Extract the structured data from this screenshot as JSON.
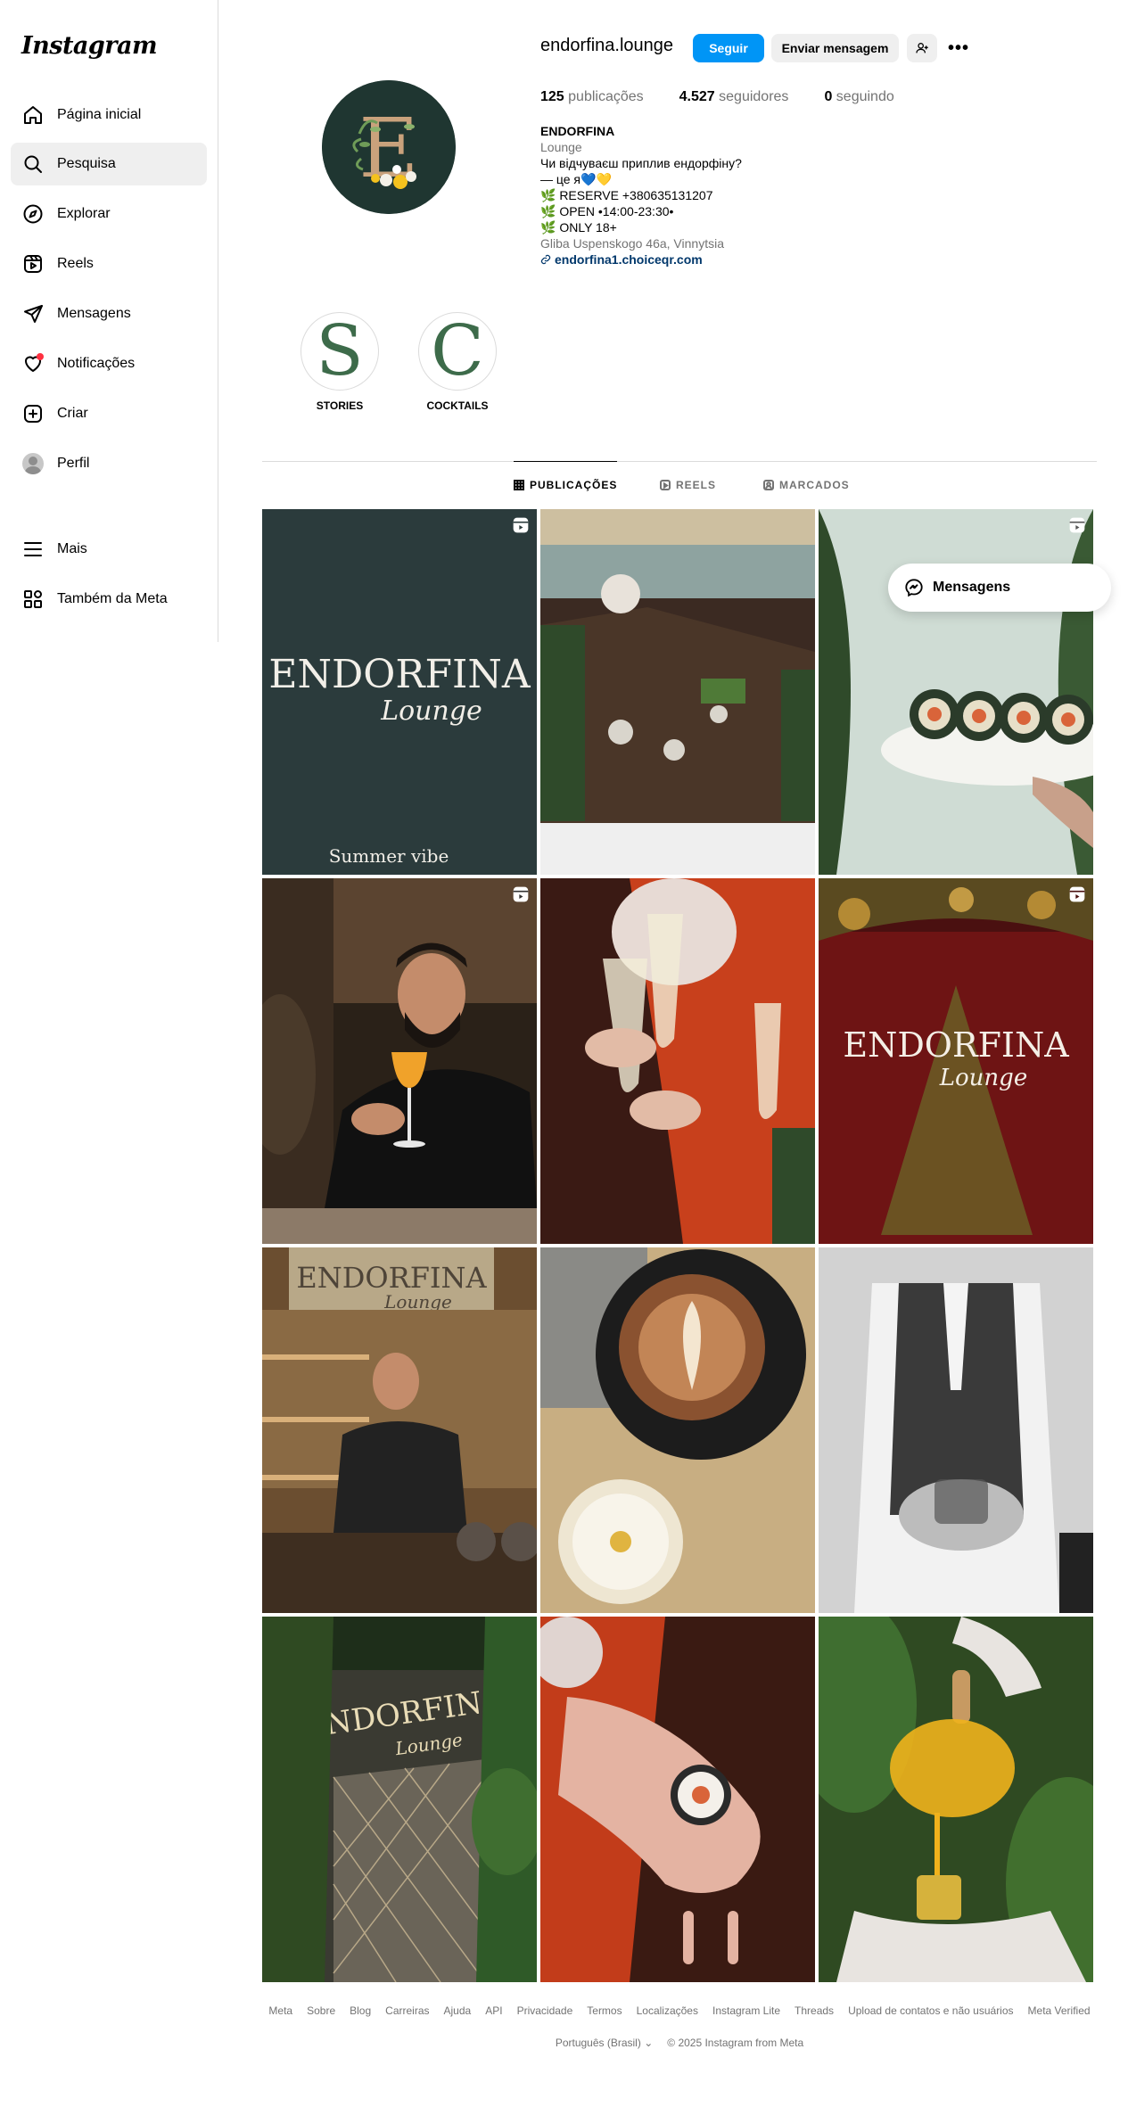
{
  "sidebar": {
    "logo": "Instagram",
    "items": [
      {
        "label": "Página inicial",
        "icon": "home-icon"
      },
      {
        "label": "Pesquisa",
        "icon": "search-icon"
      },
      {
        "label": "Explorar",
        "icon": "compass-icon"
      },
      {
        "label": "Reels",
        "icon": "reels-icon"
      },
      {
        "label": "Mensagens",
        "icon": "send-icon"
      },
      {
        "label": "Notificações",
        "icon": "heart-icon"
      },
      {
        "label": "Criar",
        "icon": "plus-square-icon"
      },
      {
        "label": "Perfil",
        "icon": "avatar-icon"
      },
      {
        "label": "Mais",
        "icon": "menu-icon"
      },
      {
        "label": "Também da Meta",
        "icon": "meta-apps-icon"
      }
    ]
  },
  "profile": {
    "username": "endorfina.lounge",
    "follow_label": "Seguir",
    "message_label": "Enviar mensagem",
    "more_label": "•••",
    "avatar_letter": "E",
    "stats": {
      "posts_count": "125",
      "posts_label": "publicações",
      "followers_count": "4.527",
      "followers_label": "seguidores",
      "following_count": "0",
      "following_label": "seguindo"
    },
    "bio": {
      "name": "ENDORFINA",
      "category": "Lounge",
      "lines": [
        "Чи відчуваєш приплив ендорфіну?",
        "— це я💙💛",
        "🌿 RESERVE +380635131207",
        "🌿 OPEN •14:00-23:30•",
        "🌿 ONLY 18+"
      ],
      "location": "Gliba Uspenskogo 46a, Vinnytsia",
      "link": "endorfina1.choiceqr.com"
    }
  },
  "highlights": [
    {
      "letter": "S",
      "label": "STORIES"
    },
    {
      "letter": "C",
      "label": "COCKTAILS"
    }
  ],
  "tabs": [
    {
      "label": "PUBLICAÇÕES",
      "active": true
    },
    {
      "label": "REELS",
      "active": false
    },
    {
      "label": "MARCADOS",
      "active": false
    }
  ],
  "posts": {
    "tile1_brand": "ENDORFINA",
    "tile1_script": "Lounge",
    "tile1_caption": "Summer vibe",
    "tile6_brand": "ENDORFINA",
    "tile6_script": "Lounge",
    "tile7_brand": "ENDORFINA",
    "tile7_script": "Lounge",
    "tile10_brand": "ENDORFINA",
    "tile10_script": "Lounge"
  },
  "floating": {
    "messages_label": "Mensagens"
  },
  "footer": {
    "links": [
      "Meta",
      "Sobre",
      "Blog",
      "Carreiras",
      "Ajuda",
      "API",
      "Privacidade",
      "Termos",
      "Localizações",
      "Instagram Lite",
      "Threads",
      "Upload de contatos e não usuários",
      "Meta Verified"
    ],
    "language": "Português (Brasil)",
    "copyright": "© 2025 Instagram from Meta"
  },
  "colors": {
    "accent": "#0095f6",
    "notification": "#ff3040",
    "link": "#00376b"
  }
}
